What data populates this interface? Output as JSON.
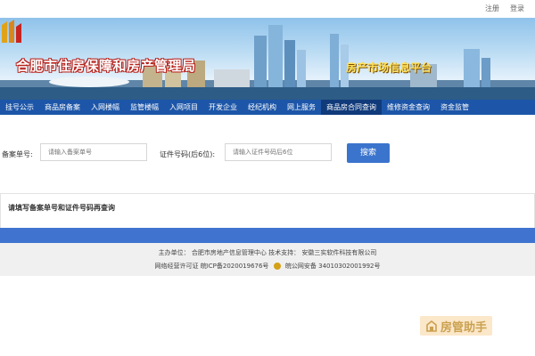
{
  "top_links": {
    "register": "注册",
    "login": "登录"
  },
  "banner": {
    "title": "合肥市住房保障和房产管理局",
    "subtitle": "房产市场信息平台"
  },
  "nav": {
    "items": [
      "挂号公示",
      "商品房备案",
      "入网楼幅",
      "监管楼幅",
      "入网项目",
      "开发企业",
      "经纪机构",
      "网上服务",
      "商品房合同查询",
      "维修资金查询",
      "资金监管"
    ],
    "active_index": 8
  },
  "search": {
    "record_label": "备案单号:",
    "record_placeholder": "请输入备案单号",
    "cert_label": "证件号码(后6位):",
    "cert_placeholder": "请输入证件号码后6位",
    "button": "搜索"
  },
  "notice": "请填写备案单号和证件号码再查询",
  "footer": {
    "line1": "主办单位：  合肥市房地产信息管理中心  技术支持：  安徽三实软件科技有限公司",
    "line2_left": "网络经营许可证  皖ICP备2020019676号",
    "line2_right": "皖公网安备 34010302001992号"
  },
  "watermark": "房管助手",
  "colors": {
    "nav": "#1d56a8",
    "nav_active": "#103a7a",
    "button": "#3b74cd",
    "bar": "#3f73cf"
  }
}
